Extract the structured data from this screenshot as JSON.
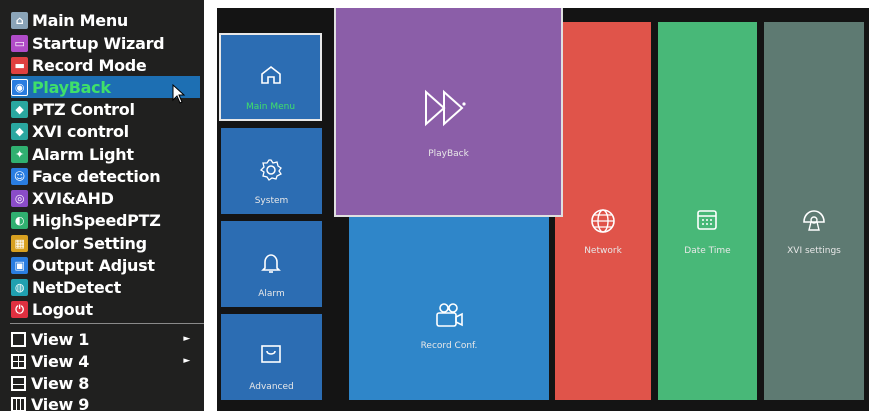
{
  "menu": {
    "items": [
      {
        "label": "Main Menu",
        "icon": "home-icon",
        "color": "#8aa4b8"
      },
      {
        "label": "Startup Wizard",
        "icon": "wizard-icon",
        "color": "#b04cc8"
      },
      {
        "label": "Record Mode",
        "icon": "record-icon",
        "color": "#e04040"
      },
      {
        "label": "PlayBack",
        "icon": "playback-icon",
        "color": "#2a7de0"
      },
      {
        "label": "PTZ Control",
        "icon": "ptz-icon",
        "color": "#2aa7a0"
      },
      {
        "label": "XVI control",
        "icon": "xvi-icon",
        "color": "#2aa7a0"
      },
      {
        "label": "Alarm Light",
        "icon": "alarm-light-icon",
        "color": "#30b070"
      },
      {
        "label": "Face detection",
        "icon": "face-icon",
        "color": "#2a7de0"
      },
      {
        "label": "XVI&AHD",
        "icon": "xvi-ahd-icon",
        "color": "#8a4cc8"
      },
      {
        "label": "HighSpeedPTZ",
        "icon": "highspeed-ptz-icon",
        "color": "#30b070"
      },
      {
        "label": "Color Setting",
        "icon": "color-icon",
        "color": "#d8a020"
      },
      {
        "label": "Output Adjust",
        "icon": "output-icon",
        "color": "#2a7de0"
      },
      {
        "label": "NetDetect",
        "icon": "netdetect-icon",
        "color": "#20a0b0"
      },
      {
        "label": "Logout",
        "icon": "power-icon",
        "color": "#e03040"
      }
    ],
    "views": [
      {
        "label": "View 1"
      },
      {
        "label": "View 4"
      },
      {
        "label": "View 8"
      },
      {
        "label": "View 9"
      }
    ],
    "selected_color": "#1d6fb3",
    "selected_text_color": "#3fe06a"
  },
  "dashboard": {
    "tiles": [
      {
        "label": "Main Menu",
        "icon": "home-icon"
      },
      {
        "label": "PlayBack",
        "icon": "fast-forward-icon"
      },
      {
        "label": "System",
        "icon": "gear-icon"
      },
      {
        "label": "Alarm",
        "icon": "bell-icon"
      },
      {
        "label": "Advanced",
        "icon": "bag-icon"
      },
      {
        "label": "Record Conf.",
        "icon": "camera-icon"
      },
      {
        "label": "Network",
        "icon": "globe-icon"
      },
      {
        "label": "Date Time",
        "icon": "calendar-icon"
      },
      {
        "label": "XVI settings",
        "icon": "dome-camera-icon"
      }
    ],
    "colors": {
      "blue": "#2c6db3",
      "record_blue": "#2f86c9",
      "purple": "#8b5ea8",
      "red": "#e0544a",
      "green": "#48b878",
      "gray": "#5e7a72"
    }
  }
}
